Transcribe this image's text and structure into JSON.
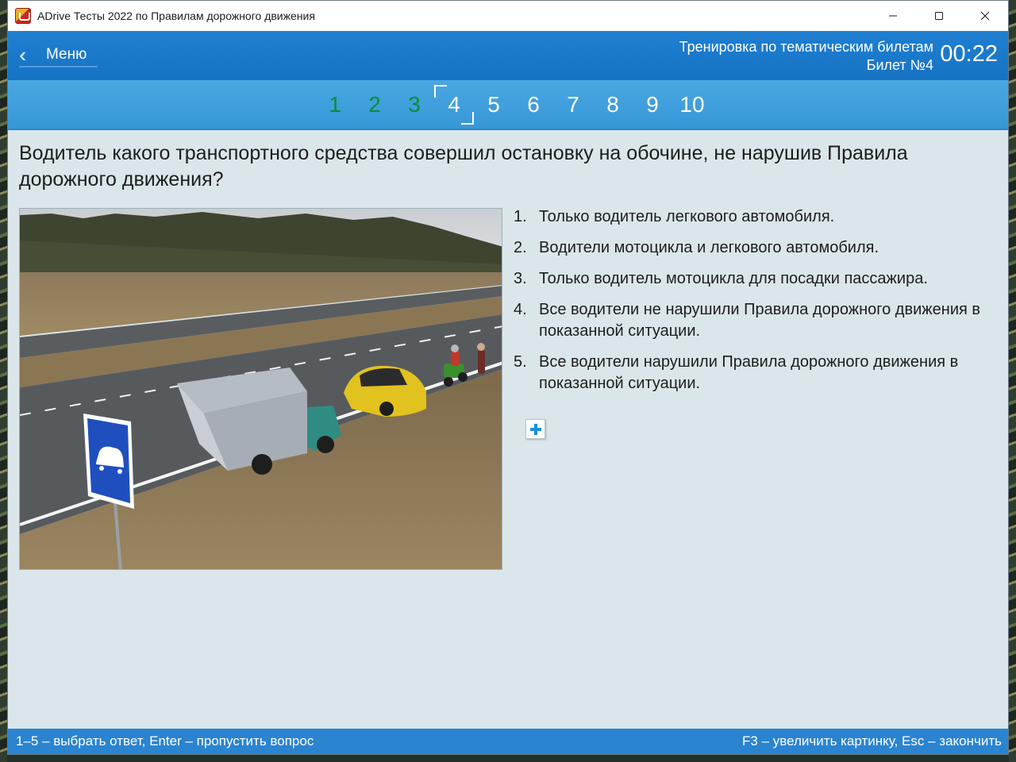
{
  "window": {
    "title": "ADrive Тесты 2022 по Правилам дорожного движения",
    "icon": "adrive-app-icon",
    "controls": [
      "minimize-icon",
      "maximize-icon",
      "close-icon"
    ]
  },
  "header": {
    "menu_label": "Меню",
    "mode": "Тренировка по тематическим билетам",
    "ticket": "Билет №4",
    "timer": "00:22",
    "accent": "#1f7fd1"
  },
  "tabs": [
    {
      "label": "1",
      "state": "answered"
    },
    {
      "label": "2",
      "state": "answered"
    },
    {
      "label": "3",
      "state": "answered"
    },
    {
      "label": "4",
      "state": "current"
    },
    {
      "label": "5",
      "state": "pending"
    },
    {
      "label": "6",
      "state": "pending"
    },
    {
      "label": "7",
      "state": "pending"
    },
    {
      "label": "8",
      "state": "pending"
    },
    {
      "label": "9",
      "state": "pending"
    },
    {
      "label": "10",
      "state": "pending"
    }
  ],
  "question": {
    "text": "Водитель какого транспортного средства совершил остановку на обочине, не нарушив Правила дорожного движения?"
  },
  "answers": [
    {
      "num": "1.",
      "text": "Только водитель легкового автомобиля."
    },
    {
      "num": "2.",
      "text": "Водители мотоцикла и легкового автомобиля."
    },
    {
      "num": "3.",
      "text": "Только водитель мотоцикла для посадки пассажира."
    },
    {
      "num": "4.",
      "text": "Все водители не нарушили Правила дорожного движения в показанной ситуации."
    },
    {
      "num": "5.",
      "text": "Все водители нарушили Правила дорожного движения в показанной ситуации."
    }
  ],
  "footer": {
    "left": "1–5 – выбрать ответ, Enter – пропустить вопрос",
    "right": "F3 – увеличить картинку, Esc – закончить"
  },
  "colors": {
    "answered_tab": "#0f8a3a",
    "pending_tab": "#ffffff",
    "content_bg": "#dbe6ea",
    "footer_bg": "#2a84cf"
  }
}
